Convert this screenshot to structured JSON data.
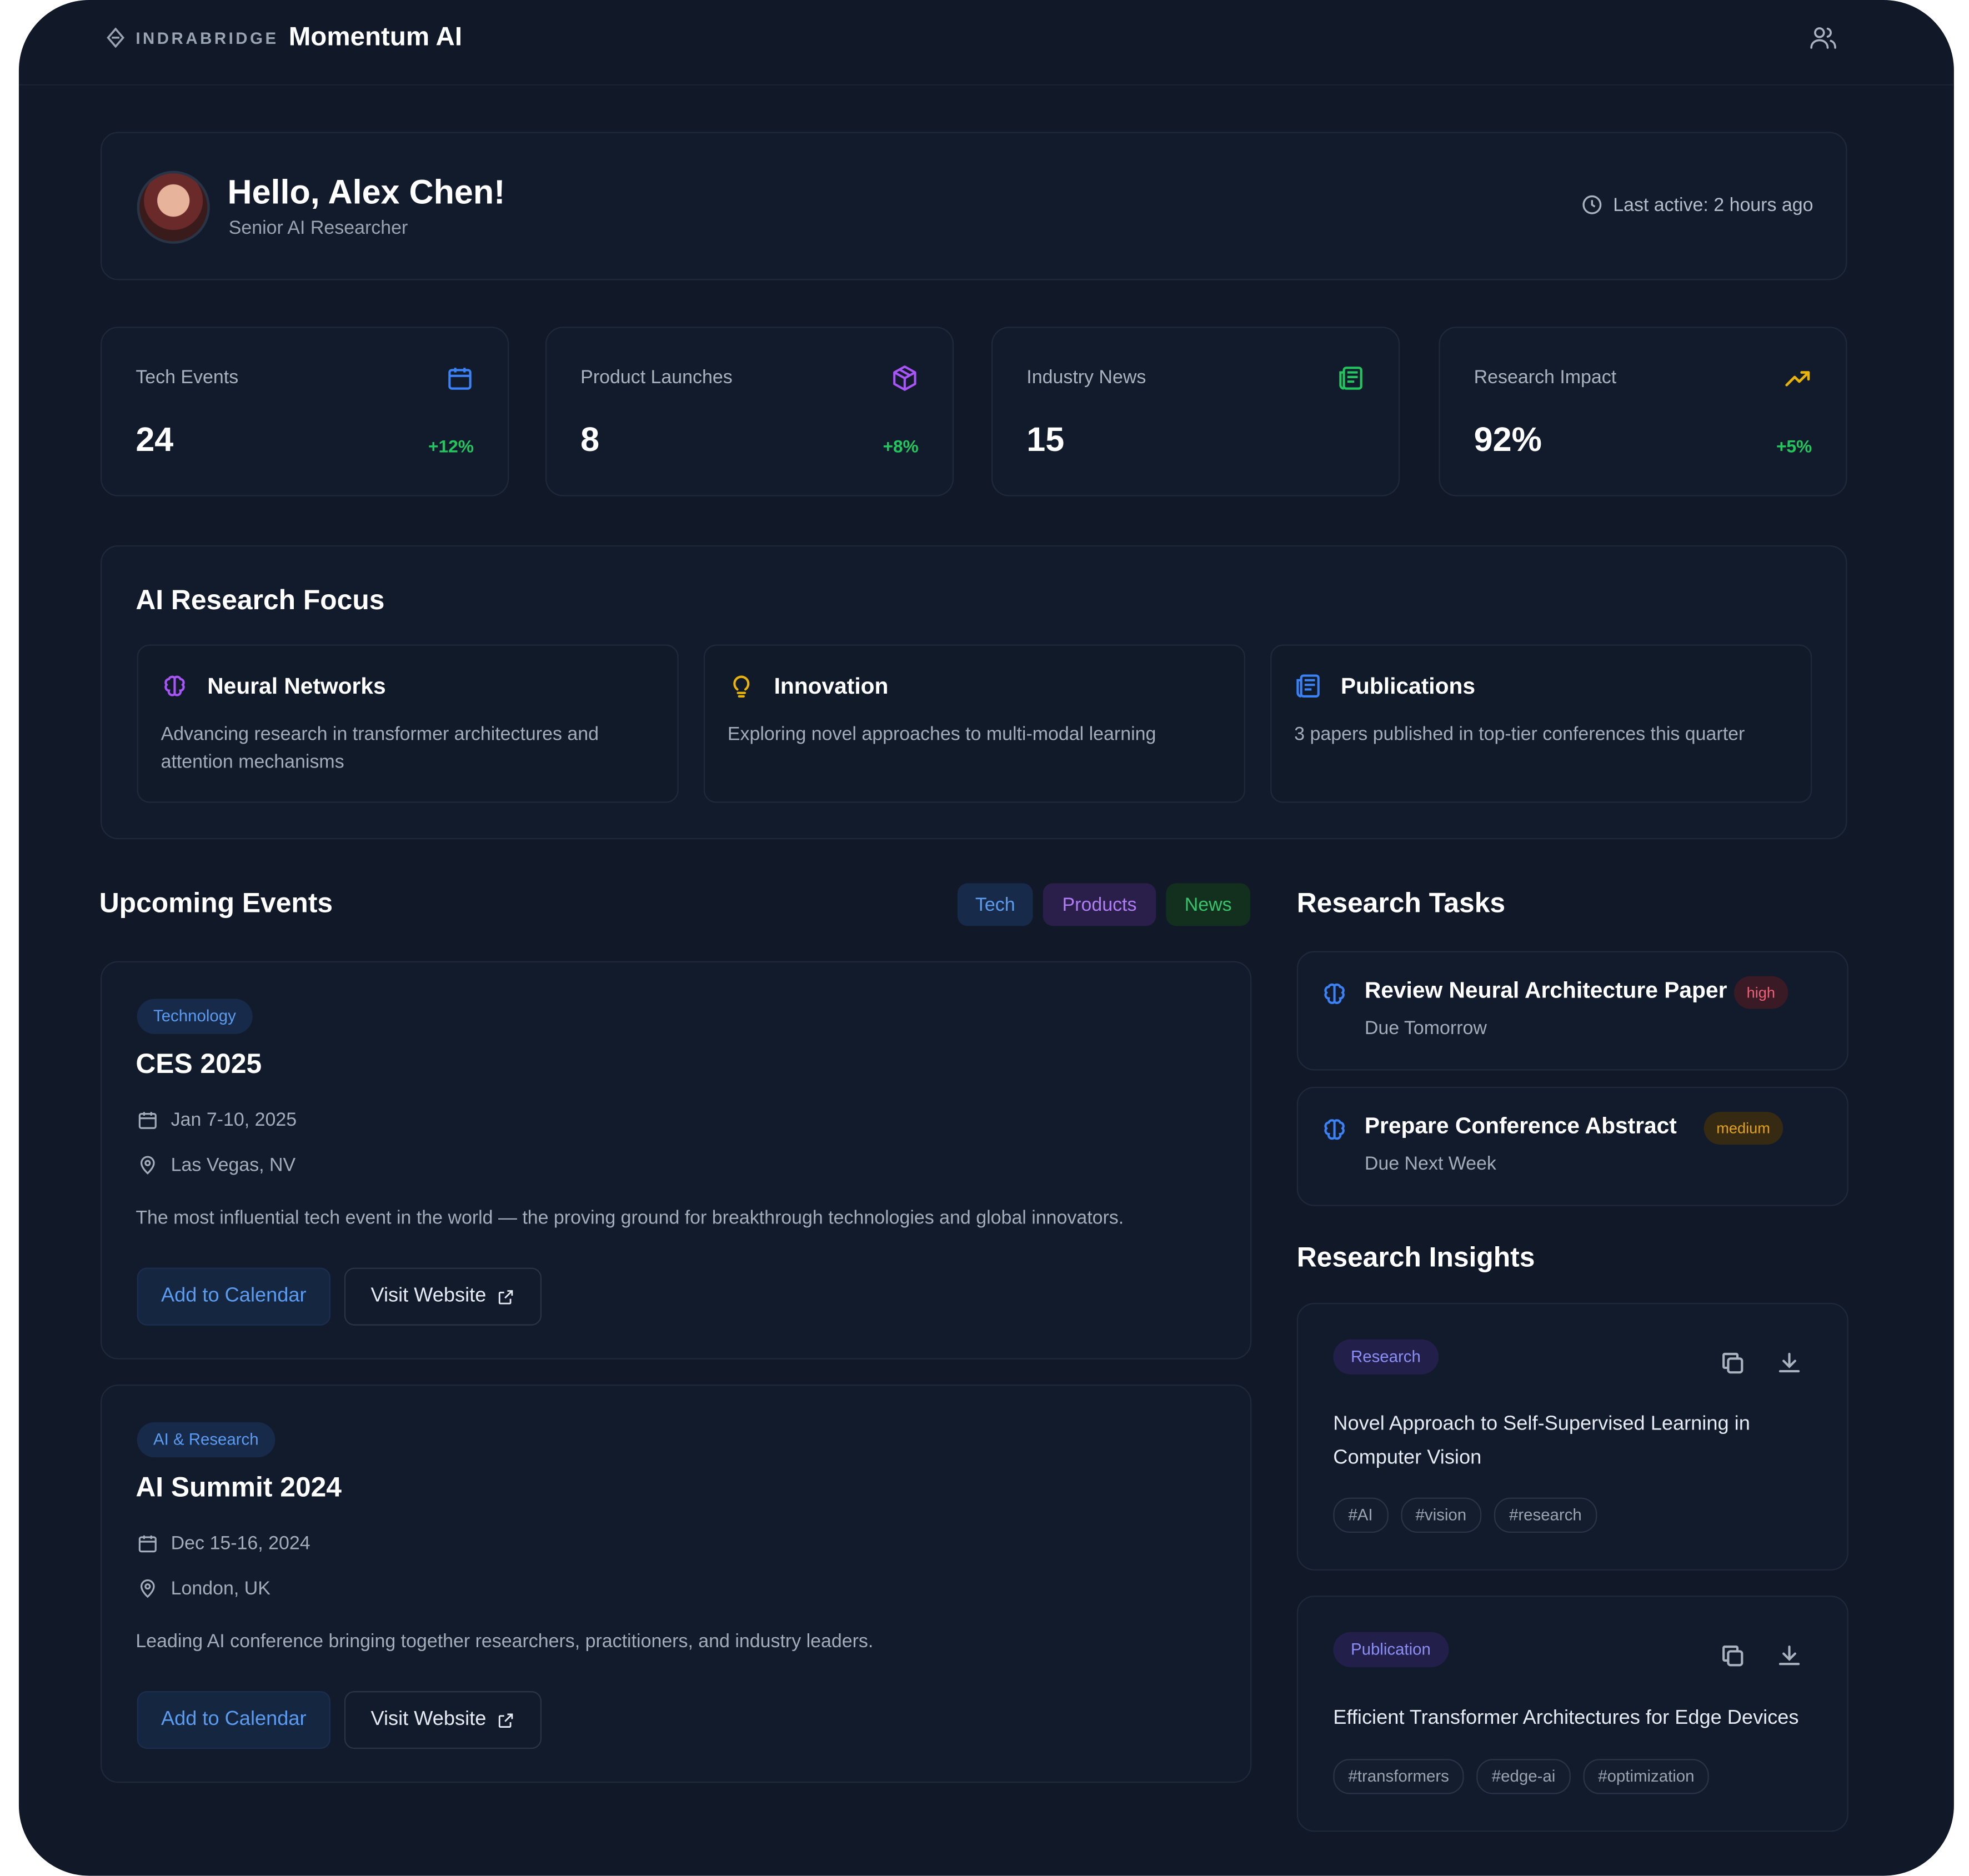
{
  "header": {
    "brand_mark": "INDRABRIDGE",
    "app_name": "Momentum AI"
  },
  "user": {
    "greeting": "Hello, Alex Chen!",
    "role": "Senior AI Researcher",
    "last_active": "Last active: 2 hours ago"
  },
  "stats": [
    {
      "label": "Tech Events",
      "value": "24",
      "delta": "+12%",
      "icon": "calendar-icon",
      "color": "#3b82f6"
    },
    {
      "label": "Product Launches",
      "value": "8",
      "delta": "+8%",
      "icon": "package-icon",
      "color": "#a855f7"
    },
    {
      "label": "Industry News",
      "value": "15",
      "delta": "",
      "icon": "newspaper-icon",
      "color": "#22c55e"
    },
    {
      "label": "Research Impact",
      "value": "92%",
      "delta": "+5%",
      "icon": "trending-up-icon",
      "color": "#eab308"
    }
  ],
  "focus": {
    "title": "AI Research Focus",
    "items": [
      {
        "title": "Neural Networks",
        "desc": "Advancing research in transformer architectures and attention mechanisms",
        "icon": "brain-icon"
      },
      {
        "title": "Innovation",
        "desc": "Exploring novel approaches to multi-modal learning",
        "icon": "lightbulb-icon"
      },
      {
        "title": "Publications",
        "desc": "3 papers published in top-tier conferences this quarter",
        "icon": "newspaper-icon"
      }
    ]
  },
  "events": {
    "title": "Upcoming Events",
    "filters": [
      "Tech",
      "Products",
      "News"
    ],
    "items": [
      {
        "tag": "Technology",
        "title": "CES 2025",
        "date": "Jan 7-10, 2025",
        "location": "Las Vegas, NV",
        "desc": "The most influential tech event in the world — the proving ground for breakthrough technologies and global innovators.",
        "cal_label": "Add to Calendar",
        "web_label": "Visit Website"
      },
      {
        "tag": "AI & Research",
        "title": "AI Summit 2024",
        "date": "Dec 15-16, 2024",
        "location": "London, UK",
        "desc": "Leading AI conference bringing together researchers, practitioners, and industry leaders.",
        "cal_label": "Add to Calendar",
        "web_label": "Visit Website"
      }
    ]
  },
  "tasks": {
    "title": "Research Tasks",
    "items": [
      {
        "title": "Review Neural Architecture Paper",
        "priority": "high",
        "due": "Due Tomorrow"
      },
      {
        "title": "Prepare Conference Abstract",
        "priority": "medium",
        "due": "Due Next Week"
      }
    ]
  },
  "insights": {
    "title": "Research Insights",
    "items": [
      {
        "tag": "Research",
        "title": "Novel Approach to Self-Supervised Learning in Computer Vision",
        "tags": [
          "#AI",
          "#vision",
          "#research"
        ]
      },
      {
        "tag": "Publication",
        "title": "Efficient Transformer Architectures for Edge Devices",
        "tags": [
          "#transformers",
          "#edge-ai",
          "#optimization"
        ]
      }
    ]
  }
}
